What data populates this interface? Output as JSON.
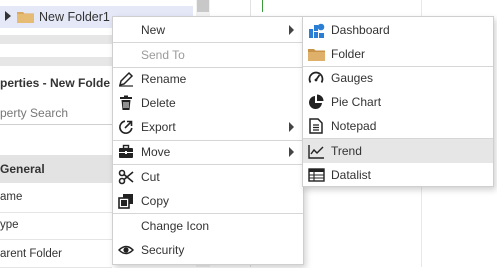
{
  "tree": {
    "label": "New Folder1"
  },
  "properties": {
    "title": "perties - New Folde",
    "search_placeholder": "perty Search",
    "section": "General",
    "rows": [
      "ame",
      "ype",
      "arent Folder"
    ]
  },
  "context_menu": {
    "items": [
      {
        "label": "New",
        "icon": "none",
        "submenu": true
      },
      {
        "label": "Send To",
        "icon": "none",
        "disabled": true
      },
      {
        "label": "Rename",
        "icon": "pencil-icon"
      },
      {
        "label": "Delete",
        "icon": "trash-icon"
      },
      {
        "label": "Export",
        "icon": "export-icon",
        "submenu": true
      },
      {
        "label": "Move",
        "icon": "briefcase-icon",
        "submenu": true
      },
      {
        "label": "Cut",
        "icon": "scissors-icon"
      },
      {
        "label": "Copy",
        "icon": "copy-icon"
      },
      {
        "label": "Change Icon",
        "icon": "none"
      },
      {
        "label": "Security",
        "icon": "eye-icon"
      }
    ]
  },
  "submenu": {
    "items": [
      {
        "label": "Dashboard",
        "icon": "dashboard-icon"
      },
      {
        "label": "Folder",
        "icon": "folder-icon"
      },
      {
        "label": "Gauges",
        "icon": "gauge-icon"
      },
      {
        "label": "Pie Chart",
        "icon": "pie-chart-icon"
      },
      {
        "label": "Notepad",
        "icon": "notepad-icon"
      },
      {
        "label": "Trend",
        "icon": "trend-icon",
        "hovered": true
      },
      {
        "label": "Datalist",
        "icon": "datalist-icon"
      }
    ]
  },
  "colors": {
    "tree_selection": "#e4e8f7",
    "folder_tan": "#d9a95f",
    "dashboard_blue": "#2a7fd4",
    "hover_gray": "#e6e6e6"
  }
}
